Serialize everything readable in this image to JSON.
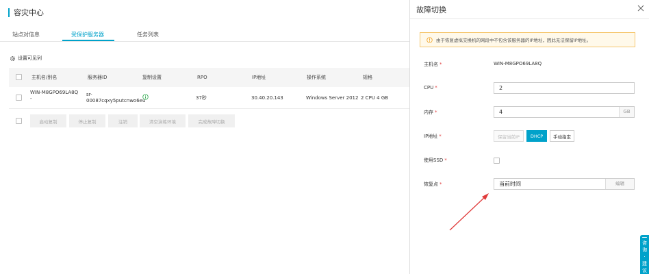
{
  "page": {
    "title": "容灾中心",
    "tabs": [
      {
        "label": "站点对信息"
      },
      {
        "label": "受保护服务器"
      },
      {
        "label": "任务列表"
      }
    ],
    "visible_columns_label": "设置可见列",
    "table": {
      "headers": [
        "主机名/别名",
        "服务器ID",
        "复制设置",
        "RPO",
        "IP地址",
        "操作系统",
        "规格"
      ],
      "row": {
        "host_line1": "WIN-M8GPO69LA8Q",
        "host_line2": "-",
        "server_id_line1": "sr-",
        "server_id_line2": "00087cqxy5putcnwo6eu",
        "rpo": "37秒",
        "ip": "30.40.20.143",
        "os": "Windows Server 2012",
        "spec": "2 CPU 4 GB"
      }
    },
    "actions": [
      "启动复制",
      "停止复制",
      "注销",
      "清空演练环境",
      "完成故障切换"
    ]
  },
  "drawer": {
    "title": "故障切换",
    "notice": "由于恢复虚拟交换机的网段中不包含该服务器的IP地址，因此无法保留IP地址。",
    "fields": {
      "hostname_label": "主机名",
      "hostname_value": "WIN-M8GPO69LA8Q",
      "cpu_label": "CPU",
      "cpu_value": "2",
      "memory_label": "内存",
      "memory_value": "4",
      "memory_unit": "GB",
      "ip_label": "IP地址",
      "ip_options": [
        "保留当前IP",
        "DHCP",
        "手动指定"
      ],
      "ssd_label": "使用SSD",
      "recovery_label": "恢复点",
      "recovery_value": "当前时间",
      "recovery_edit": "编辑"
    }
  },
  "float_tab": {
    "chars": [
      "咨",
      "询",
      "·",
      "建",
      "议"
    ]
  },
  "colors": {
    "accent": "#00a2ca",
    "required": "#e03b3b",
    "annotation_arrow": "#e03b3b",
    "notice_border": "#f5c66c"
  }
}
